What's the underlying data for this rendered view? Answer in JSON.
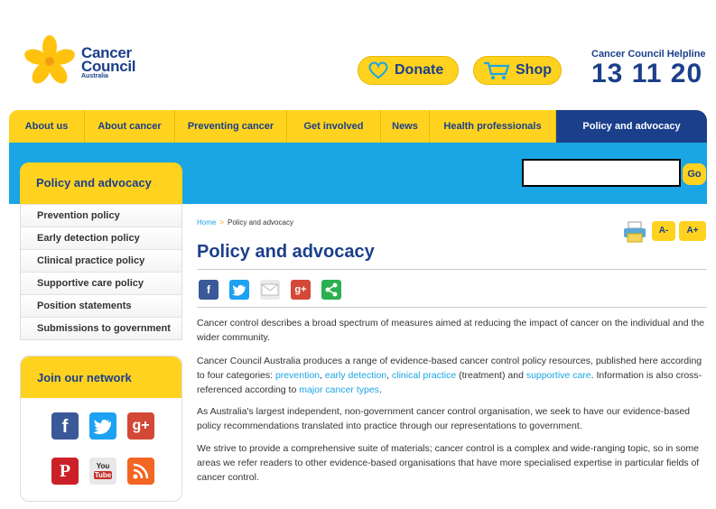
{
  "brand": {
    "line1": "Cancer",
    "line2": "Council",
    "line3": "Australia"
  },
  "header": {
    "donate": "Donate",
    "shop": "Shop",
    "helpline_title": "Cancer Council Helpline",
    "helpline_number": "13 11 20"
  },
  "nav": [
    "About us",
    "About cancer",
    "Preventing cancer",
    "Get involved",
    "News",
    "Health professionals",
    "Policy and advocacy"
  ],
  "search": {
    "value": "",
    "placeholder": "",
    "button": "Go"
  },
  "sidebar": {
    "title": "Policy and advocacy",
    "items": [
      "Prevention policy",
      "Early detection policy",
      "Clinical practice policy",
      "Supportive care policy",
      "Position statements",
      "Submissions to government"
    ]
  },
  "network": {
    "title": "Join our network",
    "icons": [
      "facebook-icon",
      "twitter-icon",
      "google-plus-icon",
      "pinterest-icon",
      "youtube-icon",
      "rss-icon"
    ]
  },
  "breadcrumb": {
    "home": "Home",
    "sep": ">",
    "current": "Policy and advocacy"
  },
  "tools": {
    "font_smaller": "A-",
    "font_larger": "A+"
  },
  "main": {
    "title": "Policy and advocacy",
    "share": [
      "facebook-icon",
      "twitter-icon",
      "email-icon",
      "google-plus-icon",
      "share-icon"
    ],
    "p1": "Cancer control describes a broad spectrum of measures aimed at reducing the impact of cancer on the individual and the wider community.",
    "p2a": "Cancer Council Australia produces a range of evidence-based cancer control policy resources, published here according to four categories: ",
    "p2_l1": "prevention",
    "p2_c1": ", ",
    "p2_l2": "early detection",
    "p2_c2": ", ",
    "p2_l3": "clinical practice",
    "p2_c3": " (treatment) and ",
    "p2_l4": "supportive care",
    "p2_c4": ". Information is also cross-referenced according to ",
    "p2_l5": "major cancer types",
    "p2_end": ".",
    "p3": "As Australia's largest independent, non-government cancer control organisation, we seek to have our evidence-based policy recommendations translated into practice through our representations to government.",
    "p4": "We strive to provide a comprehensive suite of materials; cancer control is a complex and wide-ranging topic, so in some areas we refer readers to other evidence-based organisations that have more specialised expertise in particular fields of cancer control."
  },
  "colors": {
    "navy": "#1b3f8b",
    "yellow": "#ffd21f",
    "sky": "#1aa5e4"
  }
}
